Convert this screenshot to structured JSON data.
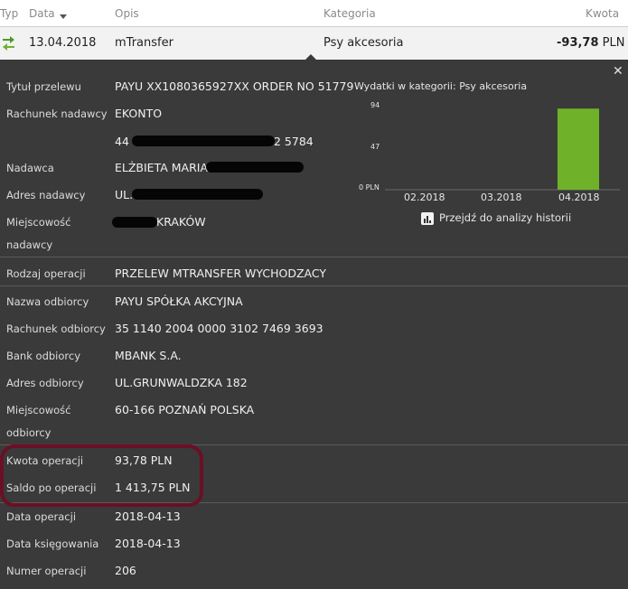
{
  "header": {
    "col_type": "Typ",
    "col_date": "Data",
    "col_desc": "Opis",
    "col_category": "Kategoria",
    "col_amount": "Kwota"
  },
  "transaction": {
    "date": "13.04.2018",
    "description": "mTransfer",
    "category": "Psy akcesoria",
    "amount": "-93,78",
    "currency": "PLN"
  },
  "details": {
    "title_label": "Tytuł przelewu",
    "title_value": "PAYU XX1080365927XX ORDER NO 51779",
    "sender_account_label": "Rachunek nadawcy",
    "sender_account_value": "EKONTO",
    "sender_account_number_prefix": "44",
    "sender_account_number_suffix": "2 5784",
    "sender_label": "Nadawca",
    "sender_value": "ELŻBIETA MARIA",
    "sender_address_label": "Adres nadawcy",
    "sender_address_value": "UL.",
    "sender_city_label_1": "Miejscowość",
    "sender_city_label_2": "nadawcy",
    "sender_city_value": "KRAKÓW",
    "operation_type_label": "Rodzaj operacji",
    "operation_type_value": "PRZELEW MTRANSFER WYCHODZACY",
    "recipient_name_label": "Nazwa odbiorcy",
    "recipient_name_value": "PAYU SPÓŁKA AKCYJNA",
    "recipient_account_label": "Rachunek odbiorcy",
    "recipient_account_value": "35 1140 2004 0000 3102 7469 3693",
    "recipient_bank_label": "Bank odbiorcy",
    "recipient_bank_value": "MBANK S.A.",
    "recipient_address_label": "Adres odbiorcy",
    "recipient_address_value": "UL.GRUNWALDZKA 182",
    "recipient_city_label_1": "Miejscowość",
    "recipient_city_label_2": "odbiorcy",
    "recipient_city_value": "60-166 POZNAŃ POLSKA",
    "amount_label": "Kwota operacji",
    "amount_value": "93,78 PLN",
    "balance_label": "Saldo po operacji",
    "balance_value": "1 413,75 PLN",
    "op_date_label": "Data operacji",
    "op_date_value": "2018-04-13",
    "booking_date_label": "Data księgowania",
    "booking_date_value": "2018-04-13",
    "op_number_label": "Numer operacji",
    "op_number_value": "206"
  },
  "analysis_link": "Przejdź do analizy historii",
  "colors": {
    "bar": "#6fb22a",
    "highlight": "#6b0f25",
    "panel": "#3a3a3a"
  },
  "icons": {
    "transfer": "transfer-arrows-icon",
    "close": "close-icon",
    "chart": "bar-chart-icon",
    "sort": "sort-down-icon"
  },
  "chart_data": {
    "type": "bar",
    "title": "Wydatki w kategorii:  Psy akcesoria",
    "categories": [
      "02.2018",
      "03.2018",
      "04.2018"
    ],
    "values": [
      0,
      0,
      93.78
    ],
    "yticks": [
      "94",
      "47",
      "0 PLN"
    ],
    "ylim": [
      0,
      94
    ],
    "grid": false
  }
}
